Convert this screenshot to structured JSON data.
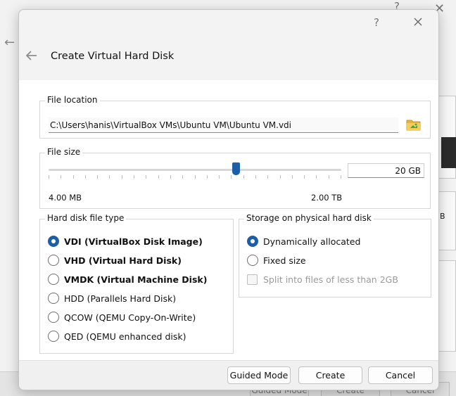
{
  "background": {
    "help_label": "?",
    "buttons": [
      "Guided Mode",
      "Create",
      "Cancel"
    ],
    "panel_text": "B"
  },
  "dialog": {
    "help_label": "?",
    "title": "Create Virtual Hard Disk"
  },
  "file_location": {
    "group_title": "File location",
    "path": "C:\\Users\\hanis\\VirtualBox VMs\\Ubuntu VM\\Ubuntu VM.vdi",
    "folder_icon": "folder-open-icon"
  },
  "file_size": {
    "group_title": "File size",
    "value": "20 GB",
    "min_label": "4.00 MB",
    "max_label": "2.00 TB",
    "slider_fraction": 0.64
  },
  "disk_type": {
    "group_title": "Hard disk file type",
    "options": [
      {
        "label": "VDI (VirtualBox Disk Image)",
        "checked": true,
        "bold": true
      },
      {
        "label": "VHD (Virtual Hard Disk)",
        "checked": false,
        "bold": true
      },
      {
        "label": "VMDK (Virtual Machine Disk)",
        "checked": false,
        "bold": true
      },
      {
        "label": "HDD (Parallels Hard Disk)",
        "checked": false,
        "bold": false
      },
      {
        "label": "QCOW (QEMU Copy-On-Write)",
        "checked": false,
        "bold": false
      },
      {
        "label": "QED (QEMU enhanced disk)",
        "checked": false,
        "bold": false
      }
    ]
  },
  "storage": {
    "group_title": "Storage on physical hard disk",
    "options": [
      {
        "label": "Dynamically allocated",
        "checked": true
      },
      {
        "label": "Fixed size",
        "checked": false
      }
    ],
    "split_label": "Split into files of less than 2GB",
    "split_checked": false,
    "split_enabled": false
  },
  "footer": {
    "guided_label": "Guided Mode",
    "create_label": "Create",
    "cancel_label": "Cancel"
  },
  "colors": {
    "accent": "#1c5fa8",
    "folder": "#e8b33a"
  }
}
